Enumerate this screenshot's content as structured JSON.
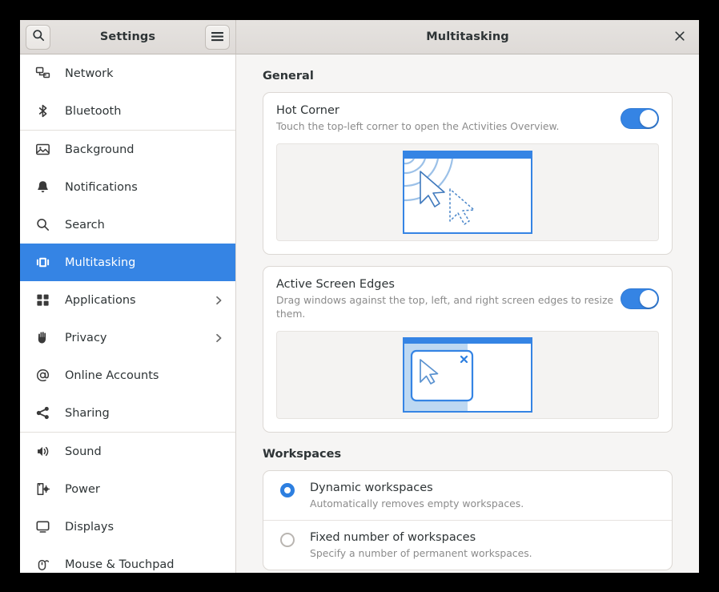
{
  "window": {
    "app_title": "Settings",
    "panel_title": "Multitasking",
    "search_icon": "search-icon",
    "menu_icon": "hamburger-menu-icon",
    "close_icon": "close-icon"
  },
  "sidebar": {
    "items": [
      {
        "label": "Network",
        "icon": "network-icon",
        "chevron": false,
        "selected": false,
        "sep_after": false
      },
      {
        "label": "Bluetooth",
        "icon": "bluetooth-icon",
        "chevron": false,
        "selected": false,
        "sep_after": true
      },
      {
        "label": "Background",
        "icon": "background-icon",
        "chevron": false,
        "selected": false,
        "sep_after": false
      },
      {
        "label": "Notifications",
        "icon": "bell-icon",
        "chevron": false,
        "selected": false,
        "sep_after": false
      },
      {
        "label": "Search",
        "icon": "search-icon",
        "chevron": false,
        "selected": false,
        "sep_after": false
      },
      {
        "label": "Multitasking",
        "icon": "multitasking-icon",
        "chevron": false,
        "selected": true,
        "sep_after": false
      },
      {
        "label": "Applications",
        "icon": "applications-icon",
        "chevron": true,
        "selected": false,
        "sep_after": false
      },
      {
        "label": "Privacy",
        "icon": "hand-icon",
        "chevron": true,
        "selected": false,
        "sep_after": false
      },
      {
        "label": "Online Accounts",
        "icon": "at-sign-icon",
        "chevron": false,
        "selected": false,
        "sep_after": false
      },
      {
        "label": "Sharing",
        "icon": "share-icon",
        "chevron": false,
        "selected": false,
        "sep_after": true
      },
      {
        "label": "Sound",
        "icon": "speaker-icon",
        "chevron": false,
        "selected": false,
        "sep_after": false
      },
      {
        "label": "Power",
        "icon": "battery-icon",
        "chevron": false,
        "selected": false,
        "sep_after": false
      },
      {
        "label": "Displays",
        "icon": "display-icon",
        "chevron": false,
        "selected": false,
        "sep_after": false
      },
      {
        "label": "Mouse & Touchpad",
        "icon": "mouse-icon",
        "chevron": false,
        "selected": false,
        "sep_after": false
      }
    ]
  },
  "content": {
    "general_heading": "General",
    "hot_corner": {
      "title": "Hot Corner",
      "subtitle": "Touch the top-left corner to open the Activities Overview.",
      "enabled": "on"
    },
    "active_edges": {
      "title": "Active Screen Edges",
      "subtitle": "Drag windows against the top, left, and right screen edges to resize them.",
      "enabled": "on"
    },
    "workspaces_heading": "Workspaces",
    "workspace_options": [
      {
        "title": "Dynamic workspaces",
        "subtitle": "Automatically removes empty workspaces.",
        "selected": true
      },
      {
        "title": "Fixed number of workspaces",
        "subtitle": "Specify a number of permanent workspaces.",
        "selected": false
      }
    ]
  },
  "colors": {
    "accent": "#3584e4",
    "radio_accent": "#2d7fe0",
    "panel_bg": "#f6f5f4",
    "illustration_blue": "#3b7fc4"
  }
}
